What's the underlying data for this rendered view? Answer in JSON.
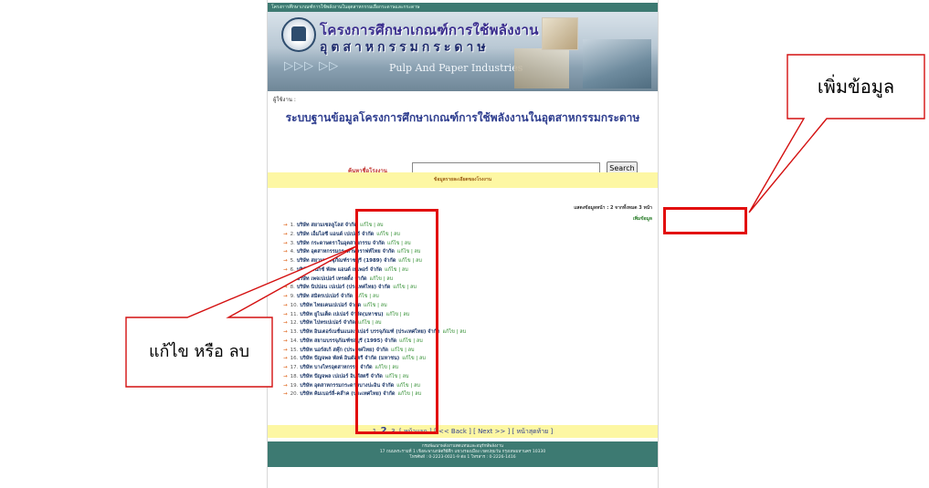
{
  "site": {
    "topbar_text": "โครงการศึกษาเกณฑ์การใช้พลังงานในอุตสาหกรรมเยื่อกระดาษและกระดาษ",
    "banner_title_th": "โครงการศึกษาเกณฑ์การใช้พลังงาน",
    "banner_title_th2": "อุตสาหกรรมกระดาษ",
    "banner_title_en": "Pulp And Paper Industries",
    "banner_arrows": "▷▷▷ ▷▷",
    "welcome": "ผู้ใช้งาน :",
    "heading": "ระบบฐานข้อมูลโครงการศึกษาเกณฑ์การใช้พลังงานในอุตสาหกรรมกระดาษ"
  },
  "search": {
    "label": "ค้นหาชื่อโรงงาน",
    "value": "",
    "button": "Search"
  },
  "notice": "ข้อมูลรายละเอียดของโรงงาน",
  "list_meta": {
    "count_text": "แสดงข้อมูลหน้า : 2 จากทั้งหมด 3 หน้า",
    "add_link": "เพิ่มข้อมูล"
  },
  "companies": [
    {
      "num": "1.",
      "name": "บริษัท สยามเซลลูโลส จำกัด",
      "edit": "แก้ไข | ลบ"
    },
    {
      "num": "2.",
      "name": "บริษัท เอ็มไอซี แอนด์ เปเปอร์ จำกัด",
      "edit": "แก้ไข | ลบ"
    },
    {
      "num": "3.",
      "name": "บริษัท กระดาษตราในอุตสาหกรรม จำกัด",
      "edit": "แก้ไข | ลบ"
    },
    {
      "num": "4.",
      "name": "บริษัท อุตสาหกรรมกระดาษคราฟท์ไทย จำกัด",
      "edit": "แก้ไข | ลบ"
    },
    {
      "num": "5.",
      "name": "บริษัท สยามบรรจุภัณฑ์ราชบุรี (1989) จำกัด",
      "edit": "แก้ไข | ลบ"
    },
    {
      "num": "6.",
      "name": "บริษัท ฟินิกซ์ พัลพ แอนด์ เพเพอร์ จำกัด",
      "edit": "แก้ไข | ลบ"
    },
    {
      "num": "7.",
      "name": "บริษัท เพจเปเปอร์ เทรดดิ้ง จำกัด",
      "edit": "แก้ไข | ลบ"
    },
    {
      "num": "8.",
      "name": "บริษัท นิปปอน เปเปอร์ (ประเทศไทย) จำกัด",
      "edit": "แก้ไข | ลบ"
    },
    {
      "num": "9.",
      "name": "บริษัท สมิตรเปเปอร์ จำกัด",
      "edit": "แก้ไข | ลบ"
    },
    {
      "num": "10.",
      "name": "บริษัท ไทยเคนเปเปอร์ จำกัด",
      "edit": "แก้ไข | ลบ"
    },
    {
      "num": "11.",
      "name": "บริษัท ยูไนเต็ด เปเปอร์ จำกัด(มหาชน)",
      "edit": "แก้ไข | ลบ"
    },
    {
      "num": "12.",
      "name": "บริษัท ไปทรเปเปอร์ จำกัด",
      "edit": "แก้ไข | ลบ"
    },
    {
      "num": "13.",
      "name": "บริษัท อินเตอร์เนชั่นแนลเปเปอร์ บรรจุภัณฑ์ (ประเทศไทย) จำกัด",
      "edit": "แก้ไข | ลบ"
    },
    {
      "num": "14.",
      "name": "บริษัท สยามบรรจุภัณฑ์ชลบุรี (1995) จำกัด",
      "edit": "แก้ไข | ลบ"
    },
    {
      "num": "15.",
      "name": "บริษัท นอร์สเก้ สคุ๊ก (ประเทศไทย) จำกัด",
      "edit": "แก้ไข | ลบ"
    },
    {
      "num": "16.",
      "name": "บริษัท ปัญจพล พัลพ์ อินดัสตรี จำกัด (มหาชน)",
      "edit": "แก้ไข | ลบ"
    },
    {
      "num": "17.",
      "name": "บริษัท บางไทรอุตสาหกรรม จำกัด",
      "edit": "แก้ไข | ลบ"
    },
    {
      "num": "18.",
      "name": "บริษัท ปัญจพล เปเปอร์ อินดัสตรี จำกัด",
      "edit": "แก้ไข | ลบ"
    },
    {
      "num": "19.",
      "name": "บริษัท อุตสาหกรรมกระดาษบางปะอิน จำกัด",
      "edit": "แก้ไข | ลบ"
    },
    {
      "num": "20.",
      "name": "บริษัท คิมเบอร์ลี่-คล๊าค (ประเทศไทย) จำกัด",
      "edit": "แก้ไข | ลบ"
    }
  ],
  "pager": {
    "p1": "1",
    "p2": "2",
    "p3": "3",
    "first": "[ หน้าแรก ]",
    "back": "[ << Back ]",
    "next": "[ Next >> ]",
    "last": "[ หน้าสุดท้าย ]"
  },
  "footer": {
    "line1": "กรมพัฒนาพลังงานทดแทนและอนุรักษ์พลังงาน",
    "line2": "17 ถนนพระรามที่ 1 เชิงสะพานกษัตริย์ศึก แขวงรองเมือง เขตปทุมวัน กรุงเทพมหานคร 10330",
    "line3": "โทรศัพท์ : 0-2223-0021-9 ต่อ 1 โทรสาร : 0-2226-1416"
  },
  "callouts": {
    "add": "เพิ่มข้อมูล",
    "edit": "แก้ไข หรือ ลบ"
  },
  "colors": {
    "highlight": "#e20d0d",
    "teal": "#3d7a72",
    "yellow_bar": "#fdf7a3"
  }
}
